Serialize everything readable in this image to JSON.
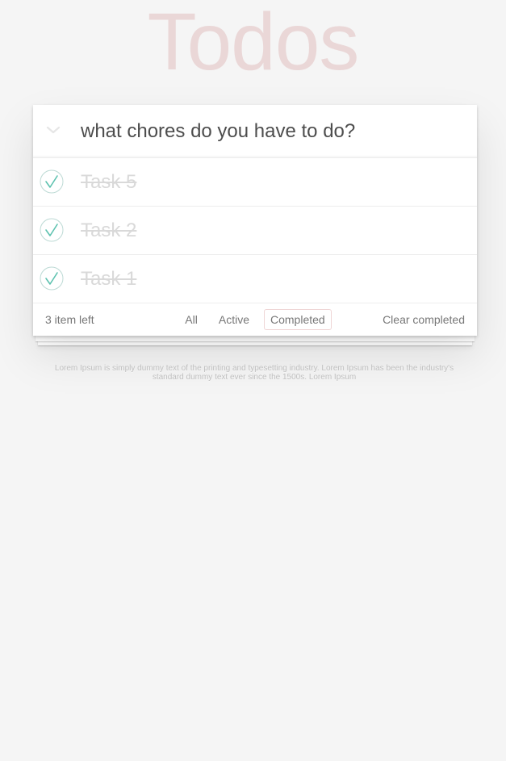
{
  "app": {
    "title": "Todos"
  },
  "new_todo": {
    "placeholder": "what chores do you have to do?",
    "value": ""
  },
  "todos": [
    {
      "label": "Task 5",
      "completed": true
    },
    {
      "label": "Task 2",
      "completed": true
    },
    {
      "label": "Task 1",
      "completed": true
    }
  ],
  "footer": {
    "count_text": "3 item left",
    "filters": [
      {
        "label": "All",
        "selected": false
      },
      {
        "label": "Active",
        "selected": false
      },
      {
        "label": "Completed",
        "selected": true
      }
    ],
    "clear_label": "Clear completed"
  },
  "info": {
    "text": "Lorem Ipsum is simply dummy text of the printing and typesetting industry. Lorem Ipsum has been the industry's standard dummy text ever since the 1500s.",
    "link_label": "Lorem Ipsum"
  },
  "colors": {
    "background": "#f5f5f5",
    "title": "#af2f2f",
    "check": "#5dc2af",
    "check_border": "#bddad5",
    "completed_text": "#d9d9d9",
    "selected_filter_border": "#af2f2f"
  },
  "icons": {
    "toggle_all": "chevron-down-icon",
    "todo_check": "check-circle-icon"
  }
}
